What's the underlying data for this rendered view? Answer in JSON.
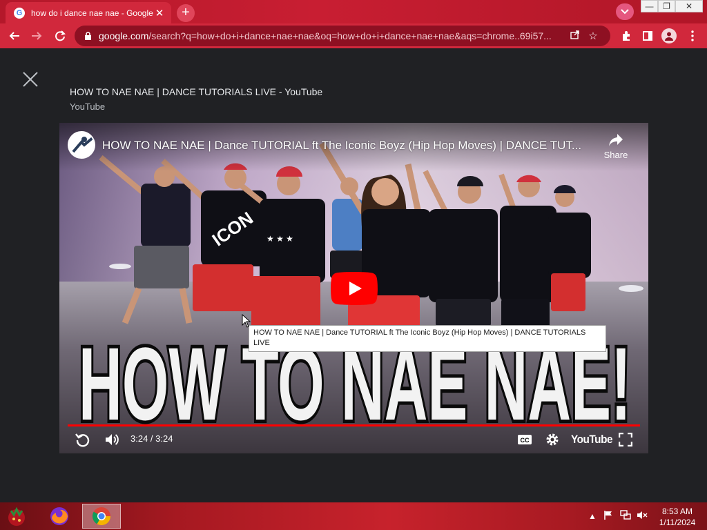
{
  "browser": {
    "tab_title": "how do i dance nae nae - Google",
    "tab_close": "✕",
    "new_tab": "+",
    "url_domain": "google.com",
    "url_path": "/search?q=how+do+i+dance+nae+nae&oq=how+do+i+dance+nae+nae&aqs=chrome..69i57...",
    "window_buttons": {
      "minimize": "—",
      "maximize": "❐",
      "close": "✕"
    }
  },
  "preview": {
    "title": "HOW TO NAE NAE | DANCE TUTORIALS LIVE - YouTube",
    "source": "YouTube"
  },
  "player": {
    "video_title": "HOW TO NAE NAE | Dance TUTORIAL ft The Iconic Boyz (Hip Hop Moves) | DANCE TUT...",
    "share_label": "Share",
    "overlay_text": "HOW TO NAE NAE!",
    "shirt_text": "ICON",
    "tooltip": "HOW TO NAE NAE | Dance TUTORIAL ft The Iconic Boyz (Hip Hop Moves) | DANCE TUTORIALS LIVE",
    "time": "3:24 / 3:24",
    "progress": 1.0,
    "brand": "YouTube",
    "cc_label": "CC",
    "accent": "#ff0000"
  },
  "taskbar": {
    "apps": [
      "firefox-icon",
      "chrome-icon"
    ],
    "clock_time": "8:53 AM",
    "clock_date": "1/11/2024"
  }
}
